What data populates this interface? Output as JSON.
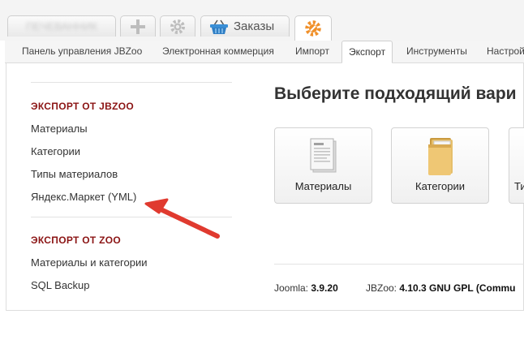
{
  "top_tabs": {
    "blurred_label": "ПЕЧЕВАННИК",
    "orders_label": "Заказы"
  },
  "subnav": {
    "items": [
      "Панель управления JBZoo",
      "Электронная коммерция",
      "Импорт",
      "Экспорт",
      "Инструменты",
      "Настрой"
    ],
    "active_index": 3
  },
  "sidebar": {
    "jbzoo_title": "ЭКСПОРТ ОТ JBZOO",
    "jbzoo_items": [
      "Материалы",
      "Категории",
      "Типы материалов",
      "Яндекс.Маркет (YML)"
    ],
    "zoo_title": "ЭКСПОРТ ОТ ZOO",
    "zoo_items": [
      "Материалы и категории",
      "SQL Backup"
    ]
  },
  "main": {
    "heading": "Выберите подходящий вари",
    "cards": [
      "Материалы",
      "Категории",
      "Ти"
    ]
  },
  "footer": {
    "joomla_label": "Joomla:",
    "joomla_version": "3.9.20",
    "jbzoo_label": "JBZoo:",
    "jbzoo_version": "4.10.3 GNU GPL (Commu"
  },
  "colors": {
    "section_title": "#8b1414",
    "annotation_arrow": "#e03a2f",
    "gear_orange": "#f0902a"
  }
}
